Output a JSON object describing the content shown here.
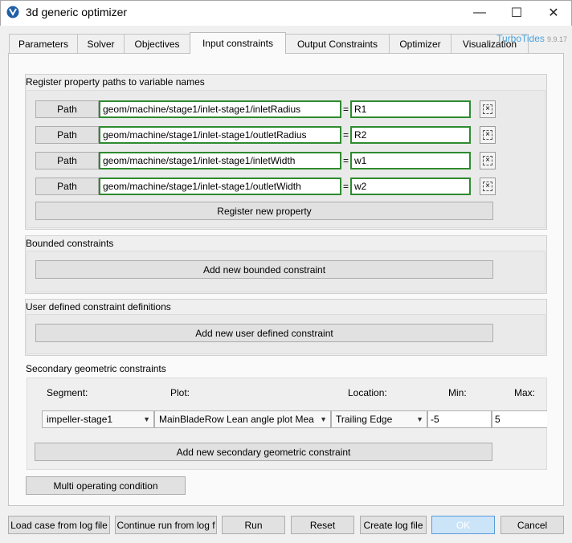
{
  "window": {
    "title": "3d generic optimizer",
    "minimize": "—",
    "maximize": "☐",
    "close": "✕"
  },
  "brand": {
    "name": "TurboTides",
    "version": "9.9.17"
  },
  "tabs": [
    "Parameters",
    "Solver",
    "Objectives",
    "Input constraints",
    "Output Constraints",
    "Optimizer",
    "Visualization"
  ],
  "register": {
    "title": "Register property paths to variable names",
    "path_label": "Path",
    "eq": "=",
    "rows": [
      {
        "path": "geom/machine/stage1/inlet-stage1/inletRadius",
        "var": "R1"
      },
      {
        "path": "geom/machine/stage1/inlet-stage1/outletRadius",
        "var": "R2"
      },
      {
        "path": "geom/machine/stage1/inlet-stage1/inletWidth",
        "var": "w1"
      },
      {
        "path": "geom/machine/stage1/inlet-stage1/outletWidth",
        "var": "w2"
      }
    ],
    "delete_glyph": "×",
    "register_button": "Register new property"
  },
  "bounded": {
    "title": "Bounded constraints",
    "add_button": "Add new bounded constraint"
  },
  "userdef": {
    "title": "User defined constraint definitions",
    "add_button": "Add new user defined constraint"
  },
  "secondary": {
    "title": "Secondary geometric constraints",
    "headers": {
      "segment": "Segment:",
      "plot": "Plot:",
      "location": "Location:",
      "min": "Min:",
      "max": "Max:"
    },
    "row": {
      "segment": "impeller-stage1",
      "plot": "MainBladeRow Lean angle plot Mea",
      "location": "Trailing Edge",
      "min": "-5",
      "max": "5"
    },
    "add_button": "Add new secondary geometric constraint"
  },
  "multi_button": "Multi operating condition",
  "bottom": {
    "load": "Load case from log file",
    "continue": "Continue run from log f",
    "run": "Run",
    "reset": "Reset",
    "create_log": "Create log file",
    "ok": "OK",
    "cancel": "Cancel"
  }
}
